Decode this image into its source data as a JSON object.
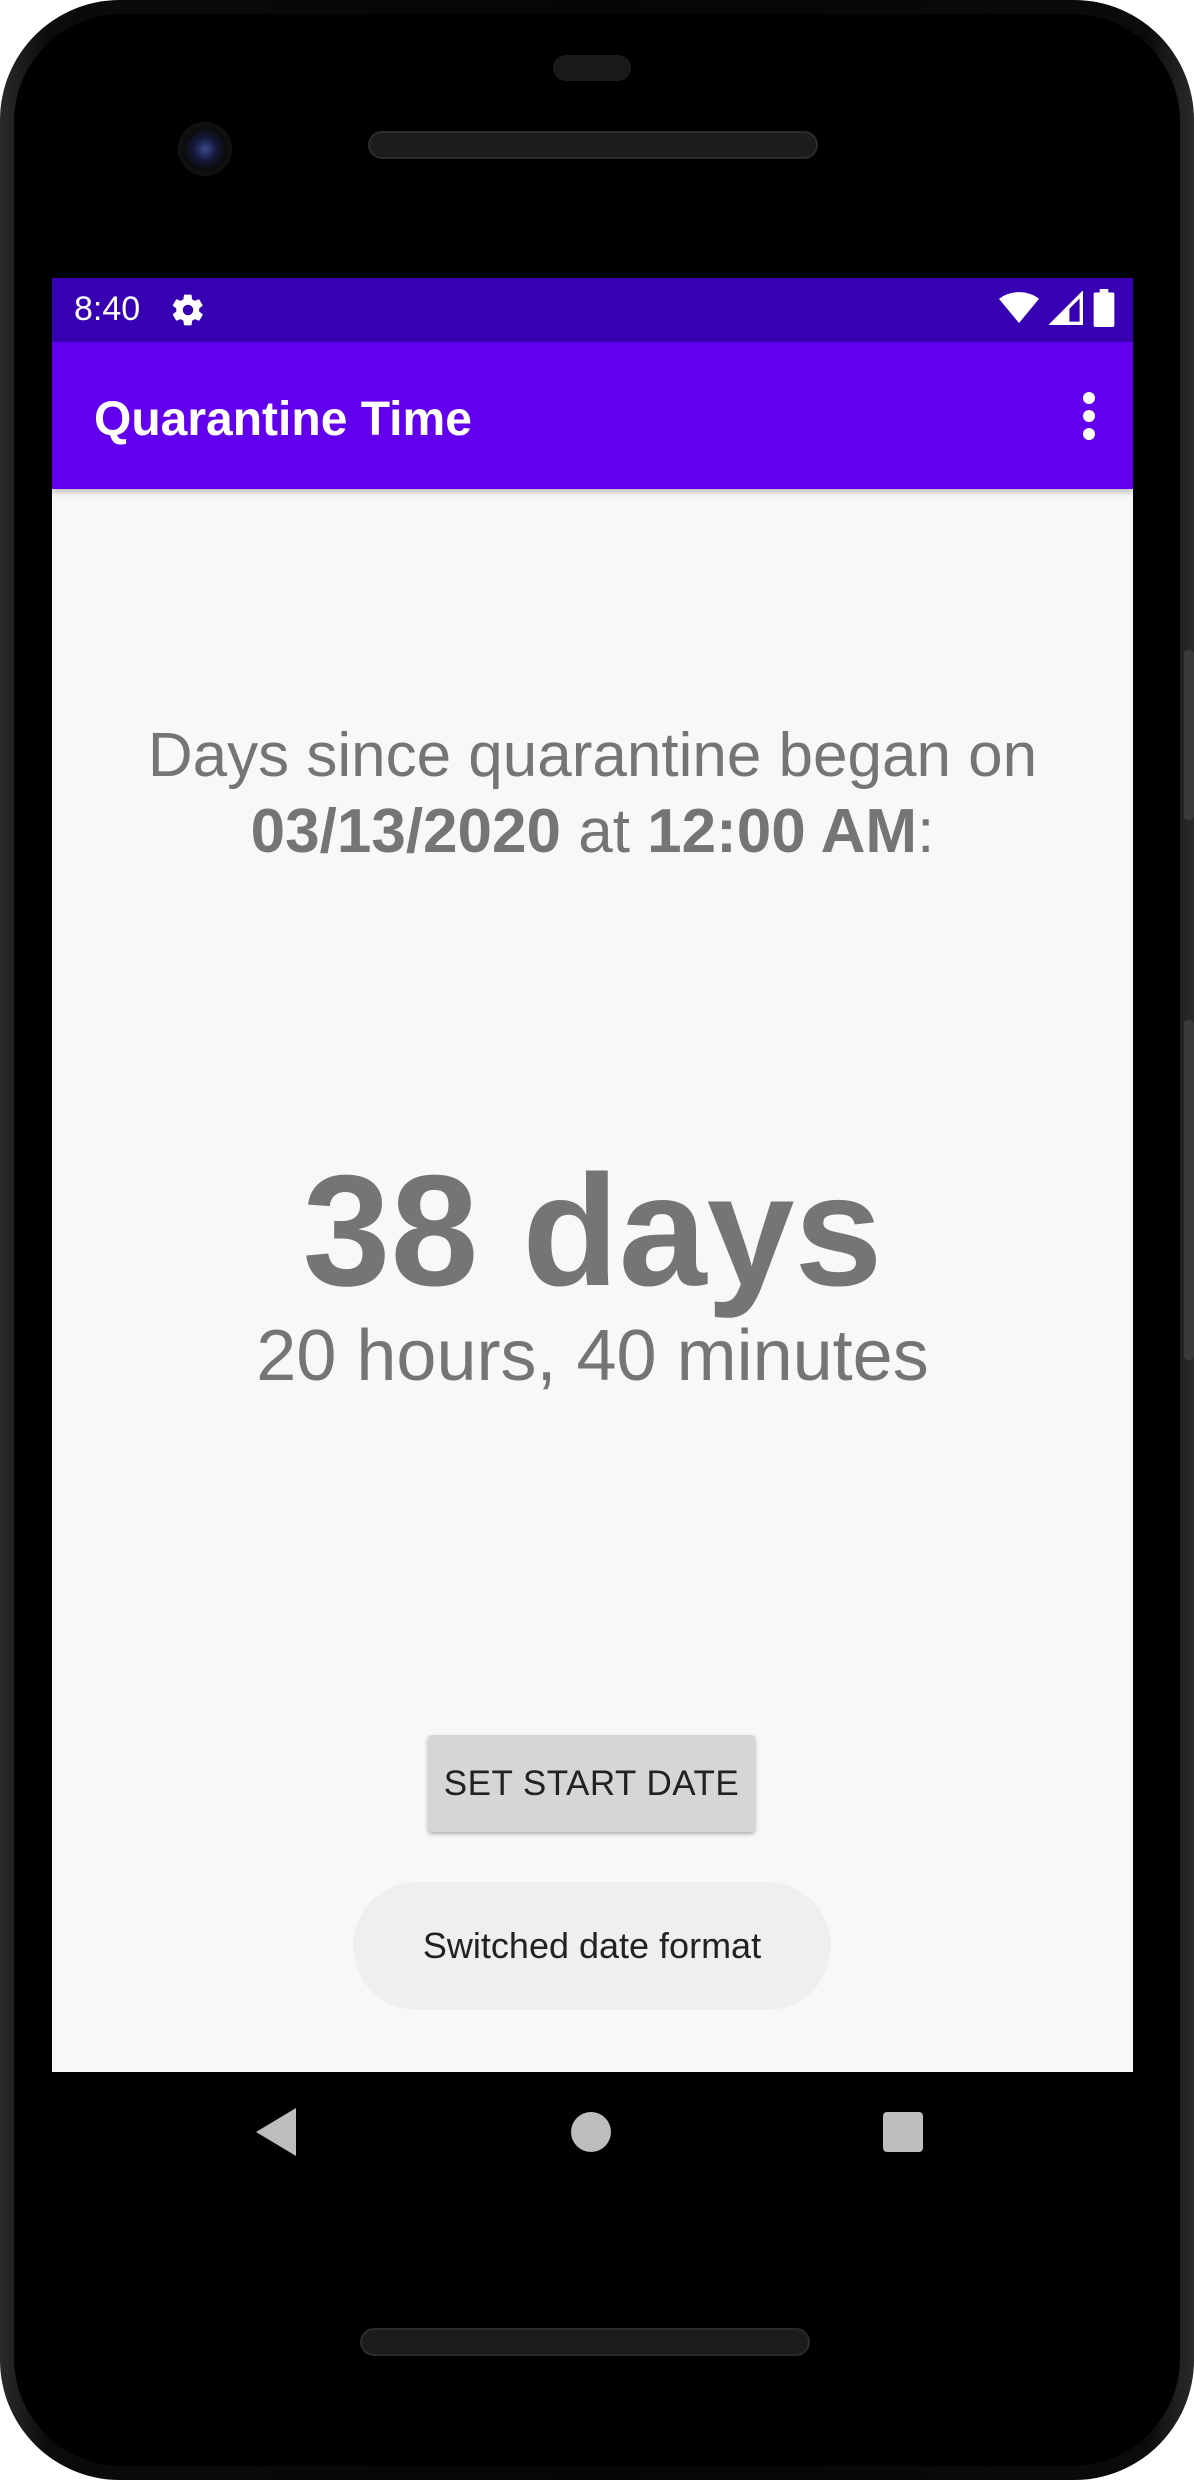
{
  "status_bar": {
    "time": "8:40",
    "background": "#3700b3"
  },
  "app_bar": {
    "title": "Quarantine Time",
    "background": "#6200ee"
  },
  "content": {
    "intro_prefix": "Days since quarantine began on",
    "start_date": "03/13/2020",
    "at_word": " at ",
    "start_time": "12:00 AM",
    "colon": ":",
    "days_label": "38 days",
    "remainder_label": "20 hours, 40 minutes",
    "text_color": "#757575"
  },
  "actions": {
    "set_start_date_label": "SET START DATE"
  },
  "toast": {
    "message": "Switched date format"
  },
  "nav_bar": {
    "back": "back-icon",
    "home": "home-icon",
    "recents": "recents-icon"
  }
}
